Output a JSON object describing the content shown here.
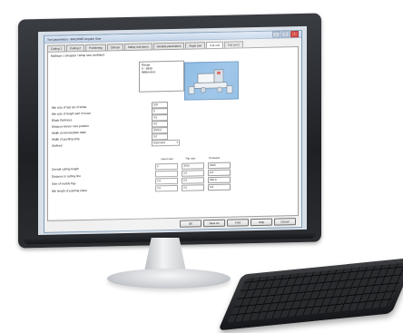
{
  "dialog": {
    "title": "Tool parameters - MACHINE Angular Saw"
  },
  "tabs": [
    {
      "label": "Cutting 1"
    },
    {
      "label": "Cutting 2"
    },
    {
      "label": "Positioning"
    },
    {
      "label": "Clamps"
    },
    {
      "label": "Safety and doors"
    },
    {
      "label": "Variable parameters"
    },
    {
      "label": "Angle saw"
    },
    {
      "label": "Pull unit"
    },
    {
      "label": "Pull unit 2"
    }
  ],
  "panel": {
    "subtitle": "Multisaw 1 (Angular / Wrap saw oscillator)",
    "range_lines": [
      "Range",
      "0 - 9999",
      "Millimeters"
    ]
  },
  "fields": [
    {
      "label": "Min size of last set of strips",
      "value": "100"
    },
    {
      "label": "Min size of length part in head",
      "value": "0"
    },
    {
      "label": "Blade thickness",
      "value": "4.5"
    },
    {
      "label": "Distance Mover max position",
      "value": "0.0"
    },
    {
      "label": "Width at intermediate table",
      "value": "2000.0"
    },
    {
      "label": "Width of pushing strip",
      "value": "0.0"
    },
    {
      "label": "Outfeed",
      "value": "Automatic"
    }
  ],
  "grid": {
    "headers": [
      "Head saw",
      "Rip saw",
      "Crosscut"
    ],
    "rows": [
      {
        "label": "Overall cutting length",
        "cells": [
          "0",
          "3000",
          "3200"
        ]
      },
      {
        "label": "Distance to cutting line",
        "cells": [
          "",
          "0.0",
          "0.0"
        ]
      },
      {
        "label": "Size of marble flap",
        "cells": [
          "0.0",
          "0.0",
          "200.0"
        ]
      },
      {
        "label": "Min length of pushing share",
        "cells": [
          "0.0",
          "0.0",
          "0.0"
        ]
      }
    ]
  },
  "buttons": {
    "ok": "OK",
    "save_as": "Save As",
    "print": "Print",
    "help": "Help",
    "cancel": "Cancel"
  },
  "colors": {
    "preview_bg": "#8cbbe4",
    "title_bar": "#c4d5ea"
  }
}
